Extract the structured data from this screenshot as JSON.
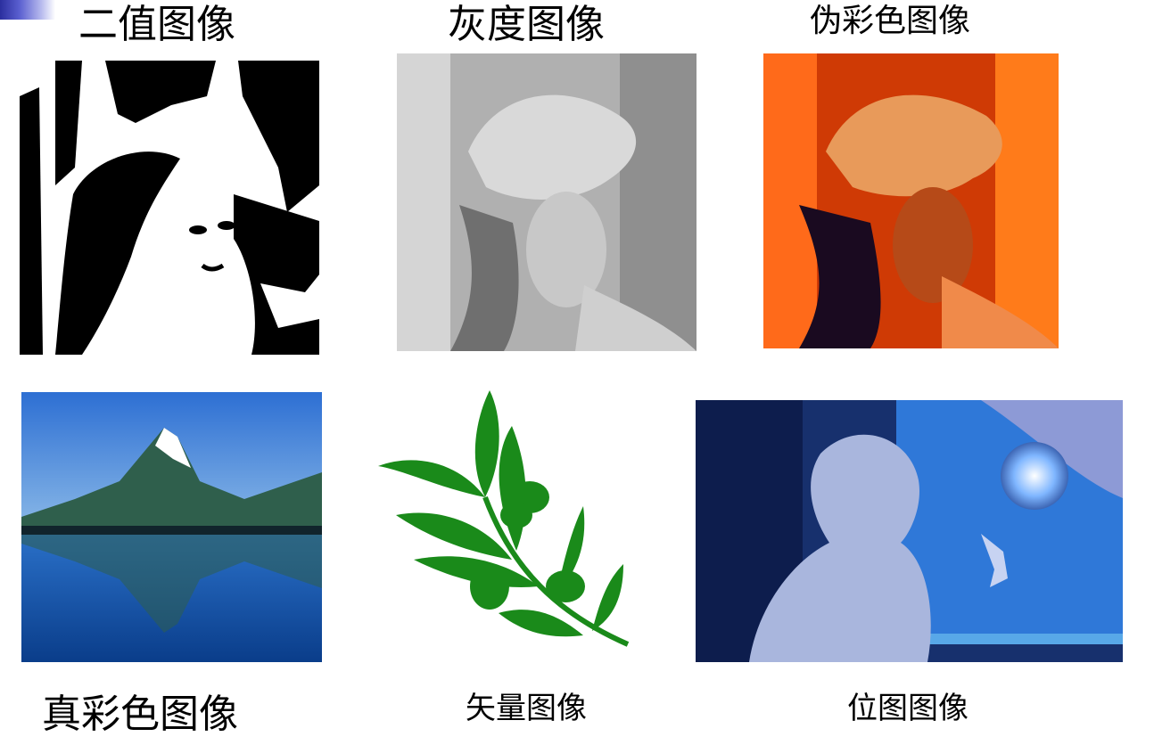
{
  "labels": {
    "binary": "二值图像",
    "gray": "灰度图像",
    "pseudo": "伪彩色图像",
    "true_color": "真彩色图像",
    "vector": "矢量图像",
    "bitmap": "位图图像"
  },
  "colors": {
    "corner_mark": "#2b2f9e",
    "vector_green": "#1a8a1a"
  }
}
